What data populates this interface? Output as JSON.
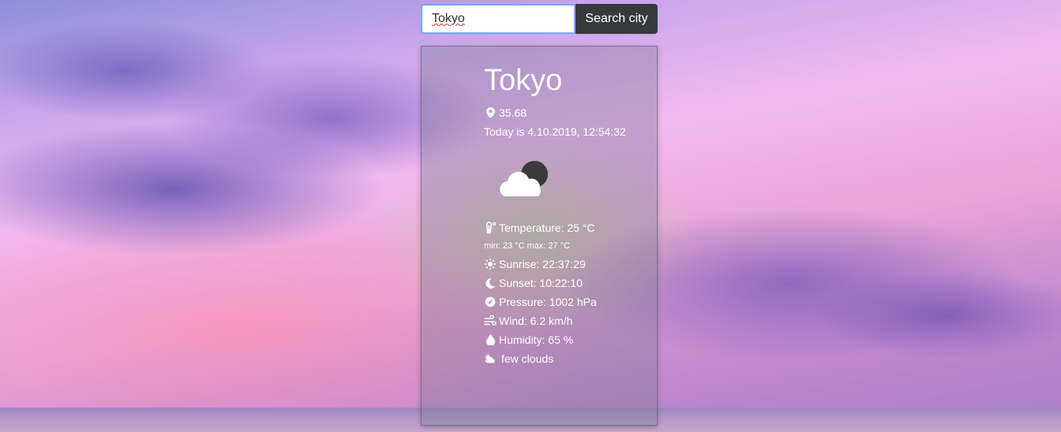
{
  "search": {
    "value": "Tokyo",
    "button_label": "Search city"
  },
  "weather": {
    "city": "Tokyo",
    "coordinate": "35.68",
    "date_text": "Today is 4.10.2019, 12:54:32",
    "condition_icon": "cloud-night-icon",
    "temperature": "Temperature: 25 °C",
    "min_max": "min: 23 °C max: 27 °C",
    "sunrise": "Sunrise: 22:37:29",
    "sunset": "Sunset: 10:22:10",
    "pressure": "Pressure: 1002 hPa",
    "wind": "Wind: 6.2 km/h",
    "humidity": "Humidity: 65 %",
    "description": "few clouds"
  },
  "icons": {
    "location": "map-marker-icon",
    "temperature": "thermometer-icon",
    "sunrise": "sun-icon",
    "sunset": "moon-icon",
    "pressure": "compass-icon",
    "wind": "wind-icon",
    "humidity": "droplet-icon",
    "description": "cloud-sun-icon"
  },
  "colors": {
    "button_bg": "#343a40",
    "input_border": "#7aa8f2",
    "text": "#ffffff"
  }
}
